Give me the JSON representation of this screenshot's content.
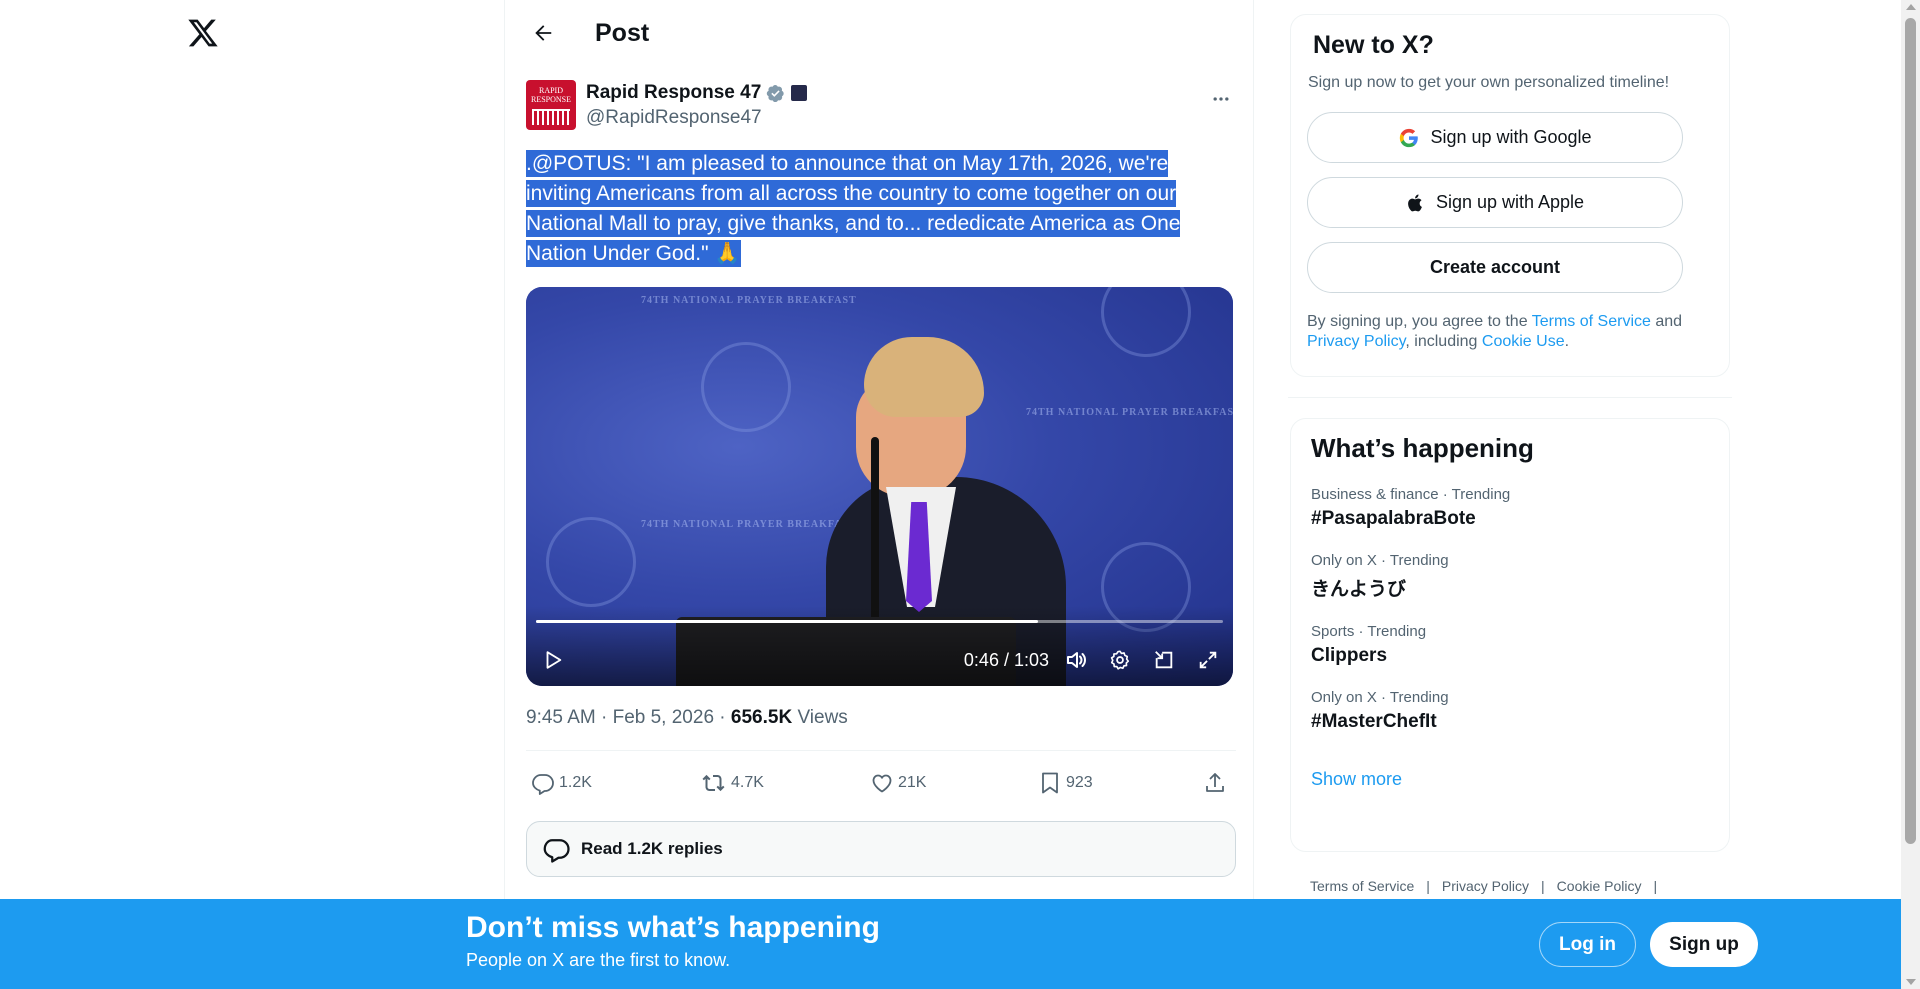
{
  "nav": {
    "logo_icon": "x-logo-icon"
  },
  "header": {
    "title": "Post",
    "back_icon": "arrow-left-icon"
  },
  "post": {
    "author_name": "Rapid Response 47",
    "author_handle": "@RapidResponse47",
    "avatar_text": "RAPID RESPONSE",
    "mention": ".@POTUS",
    "text_rest": ": \"I am pleased to announce that on May 17th, 2026, we're inviting Americans from all across the country to come together on our National Mall to pray, give thanks, and to... rededicate America as One Nation Under God.\" ",
    "emoji": "🙏",
    "video": {
      "banner_text": "74TH NATIONAL PRAYER BREAKFAST",
      "time": "0:46 / 1:03",
      "progress": 0.73
    },
    "timestamp": "9:45 AM · Feb 5, 2026",
    "separator": " · ",
    "views_count": "656.5K",
    "views_label": " Views",
    "stats": {
      "replies": "1.2K",
      "reposts": "4.7K",
      "likes": "21K",
      "bookmarks": "923"
    },
    "read_replies": "Read 1.2K replies"
  },
  "signup": {
    "title": "New to X?",
    "subtitle": "Sign up now to get your own personalized timeline!",
    "google": "Sign up with Google",
    "apple": "Sign up with Apple",
    "create": "Create account",
    "terms_prefix": "By signing up, you agree to the ",
    "terms_link": "Terms of Service",
    "terms_and": " and ",
    "privacy_link": "Privacy Policy",
    "terms_including": ", including ",
    "cookie_link": "Cookie Use",
    "terms_end": "."
  },
  "trends": {
    "title": "What’s happening",
    "items": [
      {
        "meta": "Business & finance · Trending",
        "name": "#PasapalabraBote"
      },
      {
        "meta": "Only on X · Trending",
        "name": "きんようび"
      },
      {
        "meta": "Sports · Trending",
        "name": "Clippers"
      },
      {
        "meta": "Only on X · Trending",
        "name": "#MasterChefIt"
      }
    ],
    "show_more": "Show more"
  },
  "footer": {
    "terms": "Terms of Service",
    "privacy": "Privacy Policy",
    "cookie": "Cookie Policy",
    "bar": "|"
  },
  "banner": {
    "heading": "Don’t miss what’s happening",
    "subtext": "People on X are the first to know.",
    "login": "Log in",
    "signup": "Sign up"
  },
  "colors": {
    "accent": "#1d9bf0",
    "text": "#0f1419",
    "muted": "#536471",
    "selection": "#2f6ad7"
  }
}
